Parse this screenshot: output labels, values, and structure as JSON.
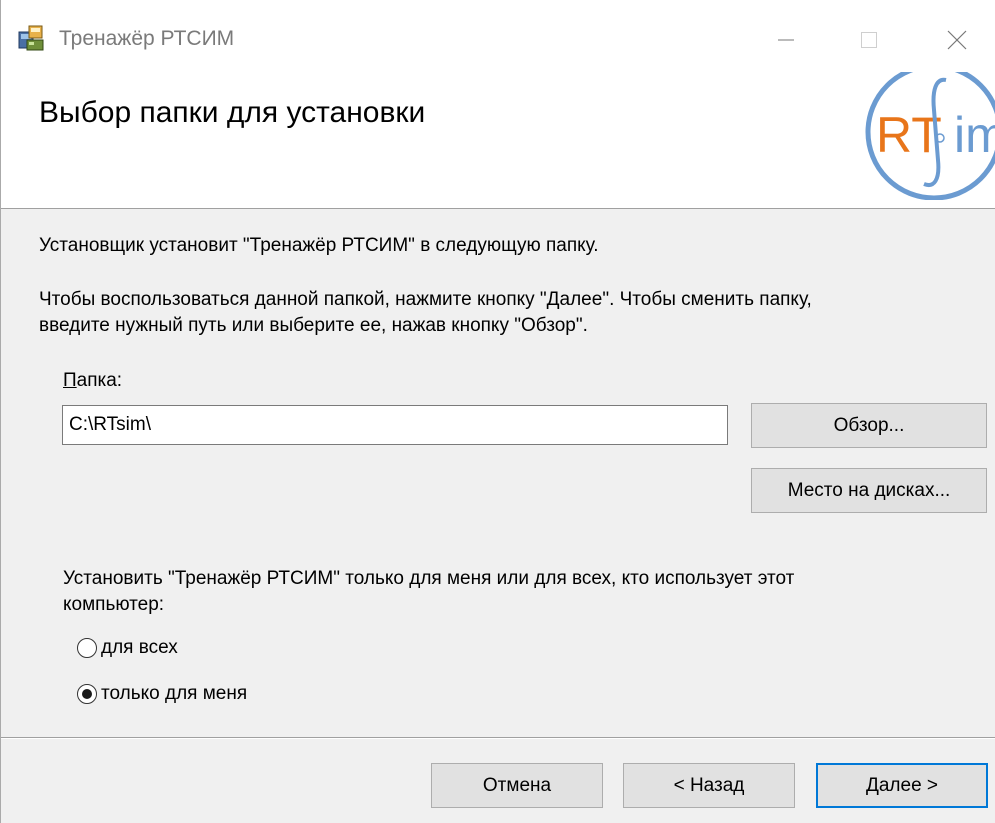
{
  "window": {
    "title": "Тренажёр РТСИМ",
    "icons": {
      "app": "installer-icon",
      "minimize": "minimize-icon",
      "maximize": "maximize-icon",
      "close": "close-icon"
    }
  },
  "header": {
    "title": "Выбор папки для установки",
    "logo": {
      "text_rt": "RT",
      "text_sim": "im",
      "colors": {
        "ring": "#6b9bd1",
        "rt": "#e8751a",
        "sim": "#6b9bd1"
      }
    }
  },
  "body": {
    "intro": "Установщик установит \"Тренажёр РТСИМ\" в следующую папку.",
    "instructions_line1": "Чтобы воспользоваться данной папкой, нажмите кнопку \"Далее\". Чтобы сменить папку,",
    "instructions_line2": "введите нужный путь или выберите ее, нажав кнопку \"Обзор\".",
    "folder_label_accel": "П",
    "folder_label_rest": "апка:",
    "folder_value": "C:\\RTsim\\",
    "browse_label": "Обзор...",
    "disk_cost_label": "Место на дисках...",
    "scope_line1": "Установить \"Тренажёр РТСИМ\" только для меня или для всех, кто использует этот",
    "scope_line2": "компьютер:",
    "radio_all_label": "для всех",
    "radio_me_label": "только для меня",
    "selected_scope": "только для меня"
  },
  "footer": {
    "cancel_label": "Отмена",
    "back_label": "< Назад",
    "next_label": "Далее >"
  },
  "colors": {
    "accent": "#0078d7",
    "button_bg": "#e1e1e1",
    "window_bg": "#f0f0f0"
  }
}
